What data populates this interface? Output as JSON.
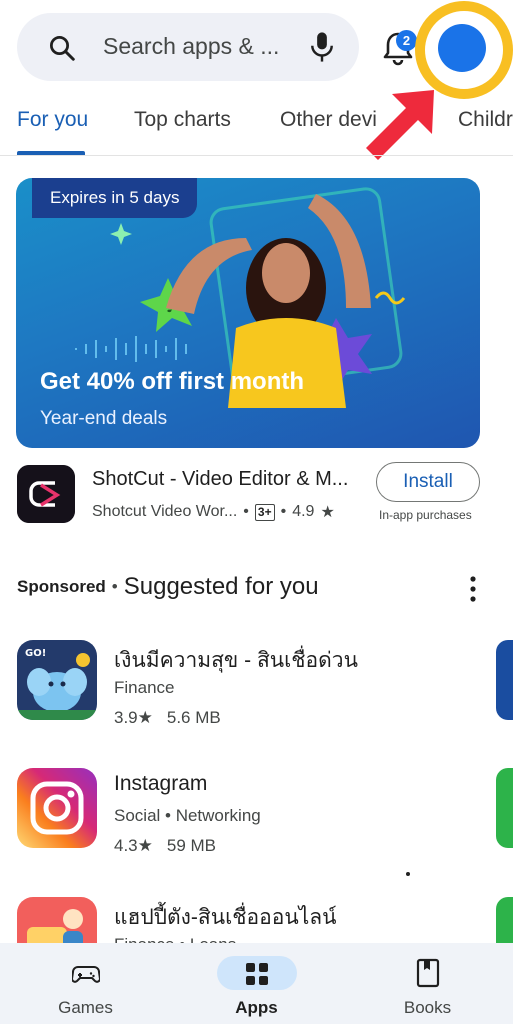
{
  "search": {
    "placeholder": "Search apps & ..."
  },
  "notifications": {
    "count": "2"
  },
  "colors": {
    "accent": "#1a5fb4",
    "highlight_ring": "#f8bf22",
    "arrow": "#ee2a3c",
    "avatar": "#1a73e8"
  },
  "tabs": [
    {
      "label": "For you",
      "active": true
    },
    {
      "label": "Top charts"
    },
    {
      "label": "Other devi"
    },
    {
      "label": "Childr"
    }
  ],
  "banner": {
    "badge": "Expires in 5 days",
    "title": "Get 40% off first month",
    "subtitle": "Year-end deals"
  },
  "featured": {
    "name": "ShotCut - Video Editor & M...",
    "developer": "Shotcut Video Wor...",
    "age_rating": "3+",
    "rating": "4.9",
    "star": "★",
    "install_label": "Install",
    "in_app": "In-app purchases"
  },
  "section": {
    "sponsored": "Sponsored",
    "separator": "•",
    "title": "Suggested for you"
  },
  "apps": [
    {
      "name": "เงินมีความสุข - สินเชื่อด่วน",
      "category": "Finance",
      "rating": "3.9★",
      "size": "5.6 MB"
    },
    {
      "name": "Instagram",
      "category": "Social • Networking",
      "rating": "4.3★",
      "size": "59 MB"
    },
    {
      "name": "แฮปปี้ตัง-สินเชื่อออนไลน์",
      "category": "Finance • Loans",
      "rating": "",
      "size": ""
    }
  ],
  "bottom_nav": [
    {
      "label": "Games",
      "icon": "gamepad-icon"
    },
    {
      "label": "Apps",
      "icon": "apps-grid-icon",
      "active": true
    },
    {
      "label": "Books",
      "icon": "book-icon"
    }
  ]
}
